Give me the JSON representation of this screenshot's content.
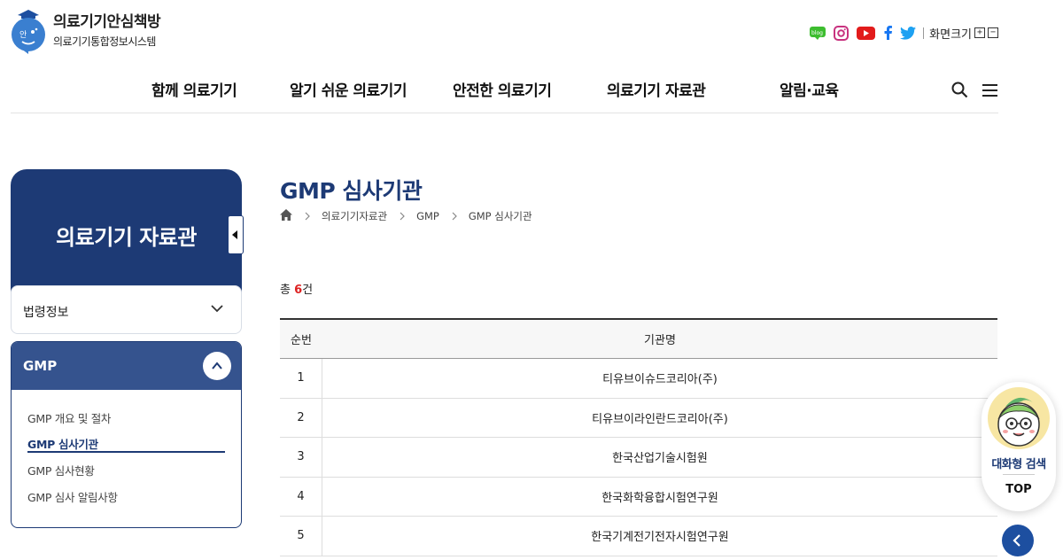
{
  "header": {
    "logo_title": "의료기기안심책방",
    "logo_subtitle": "의료기기통합정보시스템",
    "font_size_label": "화면크기",
    "font_plus": "+",
    "font_minus": "−"
  },
  "nav": {
    "items": [
      {
        "label": "함께 의료기기"
      },
      {
        "label": "알기 쉬운 의료기기"
      },
      {
        "label": "안전한 의료기기"
      },
      {
        "label": "의료기기 자료관"
      },
      {
        "label": "알림·교육"
      }
    ]
  },
  "sidebar": {
    "title": "의료기기 자료관",
    "sections": [
      {
        "label": "법령정보",
        "expanded": false
      },
      {
        "label": "GMP",
        "expanded": true
      }
    ],
    "sub_items": [
      {
        "label": "GMP 개요 및 절차"
      },
      {
        "label": "GMP 심사기관"
      },
      {
        "label": "GMP 심사현황"
      },
      {
        "label": "GMP 심사 알림사항"
      }
    ],
    "active_sub_item": "GMP 심사기관"
  },
  "main": {
    "title": "GMP 심사기관",
    "breadcrumb": [
      "의료기기자료관",
      "GMP",
      "GMP 심사기관"
    ],
    "total_prefix": "총",
    "total_count": "6",
    "total_suffix": "건",
    "table": {
      "headers": [
        "순번",
        "기관명"
      ],
      "rows": [
        [
          "1",
          "티유브이슈드코리아(주)"
        ],
        [
          "2",
          "티유브이라인란드코리아(주)"
        ],
        [
          "3",
          "한국산업기술시험원"
        ],
        [
          "4",
          "한국화학융합시험연구원"
        ],
        [
          "5",
          "한국기계전기전자시험연구원"
        ]
      ]
    }
  },
  "floating": {
    "chat_label": "대화형 검색",
    "top_label": "TOP"
  },
  "colors": {
    "primary_navy": "#1d3a75",
    "accent_blue": "#35538e",
    "count_red": "#dd2222"
  },
  "icons": [
    "blog-icon",
    "instagram-icon",
    "youtube-icon",
    "facebook-icon",
    "twitter-icon",
    "search-icon",
    "menu-icon",
    "home-icon",
    "chevron-down-icon",
    "chevron-up-icon",
    "chevron-left-icon"
  ]
}
